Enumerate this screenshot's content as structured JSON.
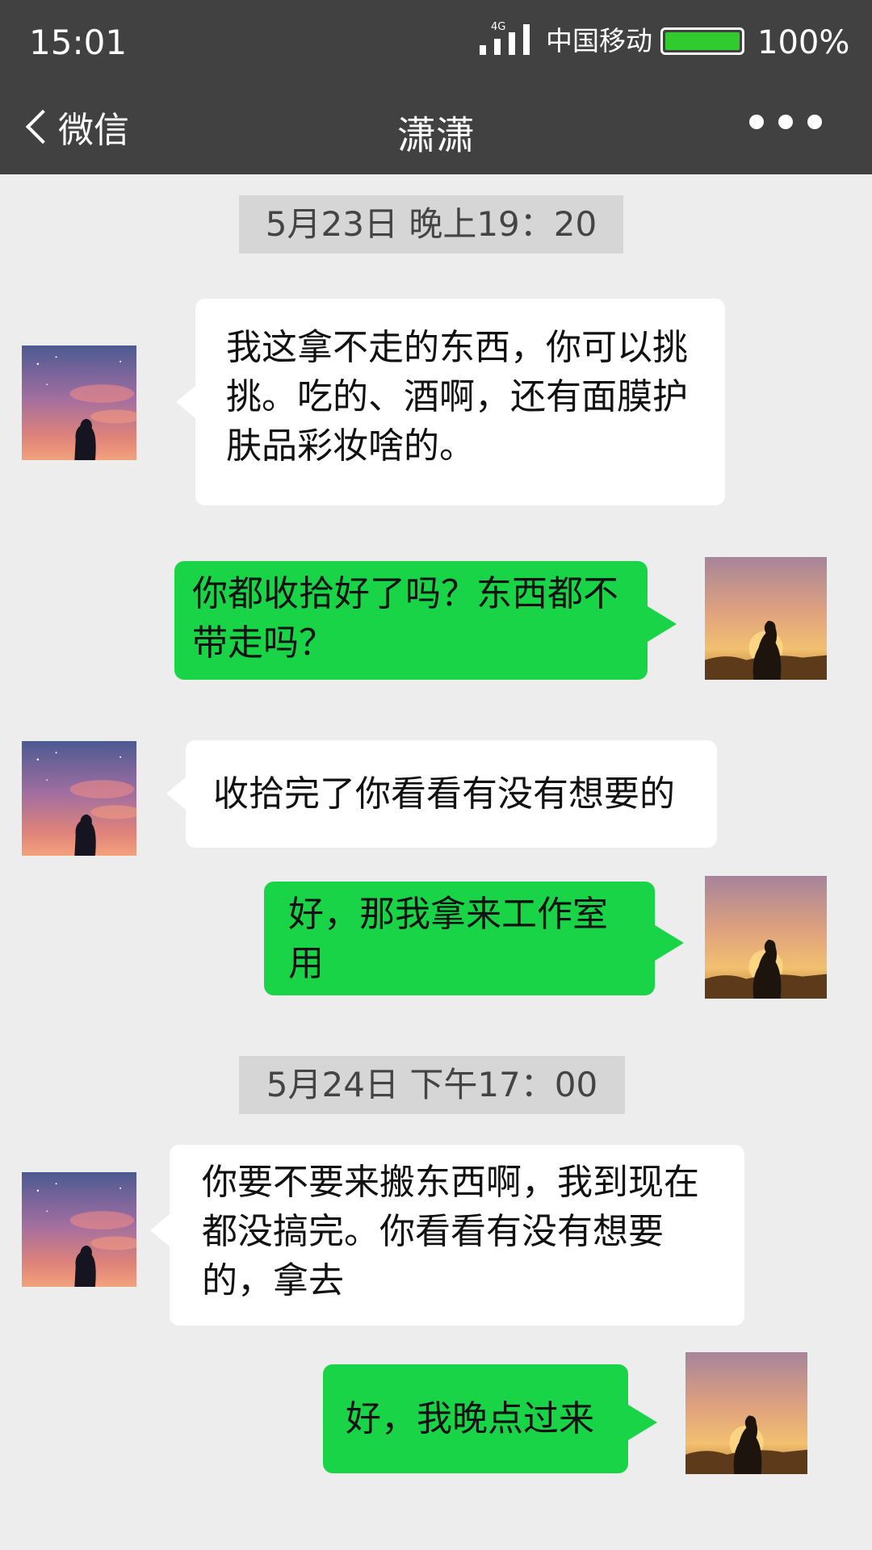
{
  "status_bar": {
    "time": "15:01",
    "network": "4G",
    "carrier": "中国移动",
    "battery_level": 1.0,
    "battery_text": "100%"
  },
  "nav": {
    "back_label": "微信",
    "title": "潇潇",
    "more_icon": "more-dots-icon"
  },
  "colors": {
    "bar_background": "#414141",
    "chat_background": "#ededed",
    "outgoing_bubble": "#19d447",
    "incoming_bubble": "#ffffff",
    "battery_fill": "#2fcb2f"
  },
  "chat": {
    "timestamps": [
      "5月23日 晚上19：20",
      "5月24日 下午17：00"
    ],
    "messages": [
      {
        "sender": "contact",
        "text": "我这拿不走的东西，你可以挑挑。吃的、酒啊，还有面膜护肤品彩妆啥的。"
      },
      {
        "sender": "me",
        "text": "你都收拾好了吗？东西都不带走吗？"
      },
      {
        "sender": "contact",
        "text": "收拾完了你看看有没有想要的"
      },
      {
        "sender": "me",
        "text": "好，那我拿来工作室用"
      },
      {
        "sender": "contact",
        "text": "你要不要来搬东西啊，我到现在都没搞完。你看看有没有想要的，拿去"
      },
      {
        "sender": "me",
        "text": "好，我晚点过来"
      }
    ]
  }
}
